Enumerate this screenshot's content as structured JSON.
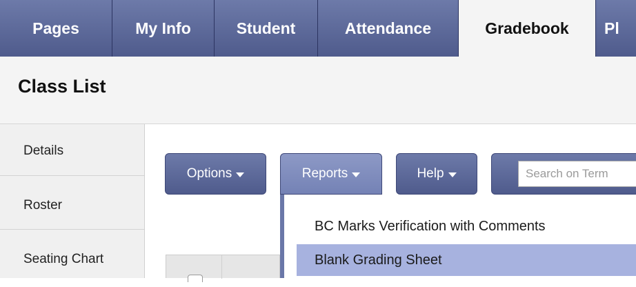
{
  "topnav": {
    "tabs": [
      {
        "label": "Pages"
      },
      {
        "label": "My Info"
      },
      {
        "label": "Student"
      },
      {
        "label": "Attendance"
      },
      {
        "label": "Gradebook",
        "active": true
      },
      {
        "label": "Pl"
      }
    ]
  },
  "header": {
    "title": "Class List"
  },
  "sidebar": {
    "items": [
      {
        "label": "Details"
      },
      {
        "label": "Roster"
      },
      {
        "label": "Seating Chart"
      }
    ]
  },
  "toolbar": {
    "options_label": "Options",
    "reports_label": "Reports",
    "help_label": "Help",
    "search_placeholder": "Search on Term"
  },
  "reports_menu": {
    "items": [
      {
        "label": "BC Marks Verification with Comments"
      },
      {
        "label": "Blank Grading Sheet",
        "highlighted": true
      }
    ]
  },
  "colors": {
    "nav_blue": "#5c689a",
    "menu_highlight": "#a7b2df"
  }
}
